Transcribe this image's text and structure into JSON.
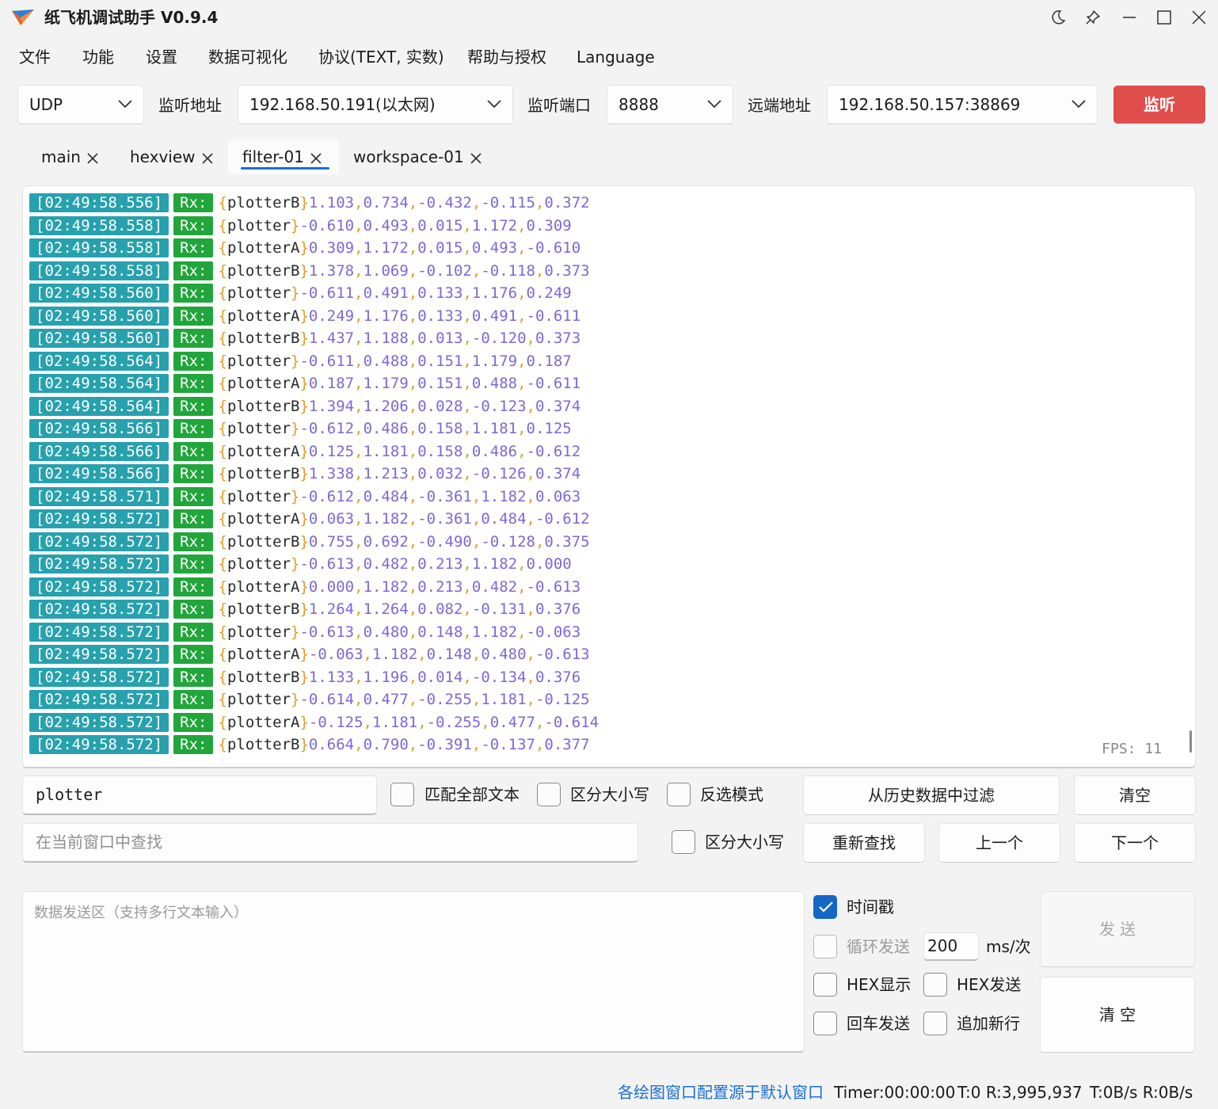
{
  "window": {
    "title": "纸飞机调试助手 V0.9.4"
  },
  "menu": [
    "文件",
    "功能",
    "设置",
    "数据可视化",
    "协议(TEXT, 实数)",
    "帮助与授权",
    "Language"
  ],
  "toolbar": {
    "protocol": "UDP",
    "listen_addr_label": "监听地址",
    "listen_addr": "192.168.50.191(以太网)",
    "listen_port_label": "监听端口",
    "listen_port": "8888",
    "remote_addr_label": "远端地址",
    "remote_addr": "192.168.50.157:38869",
    "listen_button": "监听"
  },
  "tabs": [
    {
      "label": "main",
      "active": false
    },
    {
      "label": "hexview",
      "active": false
    },
    {
      "label": "filter-01",
      "active": true
    },
    {
      "label": "workspace-01",
      "active": false
    }
  ],
  "log": {
    "rx_label": "Rx:",
    "fps": "FPS: 11",
    "rows": [
      {
        "ts": "[02:49:58.556]",
        "name": "plotterB",
        "values": [
          "1.103",
          "0.734",
          "-0.432",
          "-0.115",
          "0.372"
        ]
      },
      {
        "ts": "[02:49:58.558]",
        "name": "plotter",
        "values": [
          "-0.610",
          "0.493",
          "0.015",
          "1.172",
          "0.309"
        ]
      },
      {
        "ts": "[02:49:58.558]",
        "name": "plotterA",
        "values": [
          "0.309",
          "1.172",
          "0.015",
          "0.493",
          "-0.610"
        ]
      },
      {
        "ts": "[02:49:58.558]",
        "name": "plotterB",
        "values": [
          "1.378",
          "1.069",
          "-0.102",
          "-0.118",
          "0.373"
        ]
      },
      {
        "ts": "[02:49:58.560]",
        "name": "plotter",
        "values": [
          "-0.611",
          "0.491",
          "0.133",
          "1.176",
          "0.249"
        ]
      },
      {
        "ts": "[02:49:58.560]",
        "name": "plotterA",
        "values": [
          "0.249",
          "1.176",
          "0.133",
          "0.491",
          "-0.611"
        ]
      },
      {
        "ts": "[02:49:58.560]",
        "name": "plotterB",
        "values": [
          "1.437",
          "1.188",
          "0.013",
          "-0.120",
          "0.373"
        ]
      },
      {
        "ts": "[02:49:58.564]",
        "name": "plotter",
        "values": [
          "-0.611",
          "0.488",
          "0.151",
          "1.179",
          "0.187"
        ]
      },
      {
        "ts": "[02:49:58.564]",
        "name": "plotterA",
        "values": [
          "0.187",
          "1.179",
          "0.151",
          "0.488",
          "-0.611"
        ]
      },
      {
        "ts": "[02:49:58.564]",
        "name": "plotterB",
        "values": [
          "1.394",
          "1.206",
          "0.028",
          "-0.123",
          "0.374"
        ]
      },
      {
        "ts": "[02:49:58.566]",
        "name": "plotter",
        "values": [
          "-0.612",
          "0.486",
          "0.158",
          "1.181",
          "0.125"
        ]
      },
      {
        "ts": "[02:49:58.566]",
        "name": "plotterA",
        "values": [
          "0.125",
          "1.181",
          "0.158",
          "0.486",
          "-0.612"
        ]
      },
      {
        "ts": "[02:49:58.566]",
        "name": "plotterB",
        "values": [
          "1.338",
          "1.213",
          "0.032",
          "-0.126",
          "0.374"
        ]
      },
      {
        "ts": "[02:49:58.571]",
        "name": "plotter",
        "values": [
          "-0.612",
          "0.484",
          "-0.361",
          "1.182",
          "0.063"
        ]
      },
      {
        "ts": "[02:49:58.572]",
        "name": "plotterA",
        "values": [
          "0.063",
          "1.182",
          "-0.361",
          "0.484",
          "-0.612"
        ]
      },
      {
        "ts": "[02:49:58.572]",
        "name": "plotterB",
        "values": [
          "0.755",
          "0.692",
          "-0.490",
          "-0.128",
          "0.375"
        ]
      },
      {
        "ts": "[02:49:58.572]",
        "name": "plotter",
        "values": [
          "-0.613",
          "0.482",
          "0.213",
          "1.182",
          "0.000"
        ]
      },
      {
        "ts": "[02:49:58.572]",
        "name": "plotterA",
        "values": [
          "0.000",
          "1.182",
          "0.213",
          "0.482",
          "-0.613"
        ]
      },
      {
        "ts": "[02:49:58.572]",
        "name": "plotterB",
        "values": [
          "1.264",
          "1.264",
          "0.082",
          "-0.131",
          "0.376"
        ]
      },
      {
        "ts": "[02:49:58.572]",
        "name": "plotter",
        "values": [
          "-0.613",
          "0.480",
          "0.148",
          "1.182",
          "-0.063"
        ]
      },
      {
        "ts": "[02:49:58.572]",
        "name": "plotterA",
        "values": [
          "-0.063",
          "1.182",
          "0.148",
          "0.480",
          "-0.613"
        ]
      },
      {
        "ts": "[02:49:58.572]",
        "name": "plotterB",
        "values": [
          "1.133",
          "1.196",
          "0.014",
          "-0.134",
          "0.376"
        ]
      },
      {
        "ts": "[02:49:58.572]",
        "name": "plotter",
        "values": [
          "-0.614",
          "0.477",
          "-0.255",
          "1.181",
          "-0.125"
        ]
      },
      {
        "ts": "[02:49:58.572]",
        "name": "plotterA",
        "values": [
          "-0.125",
          "1.181",
          "-0.255",
          "0.477",
          "-0.614"
        ]
      },
      {
        "ts": "[02:49:58.572]",
        "name": "plotterB",
        "values": [
          "0.664",
          "0.790",
          "-0.391",
          "-0.137",
          "0.377"
        ]
      }
    ]
  },
  "filter": {
    "value": "plotter",
    "match_all_label": "匹配全部文本",
    "case_label": "区分大小写",
    "invert_label": "反选模式",
    "history_button": "从历史数据中过滤",
    "clear_button": "清空"
  },
  "find": {
    "placeholder": "在当前窗口中查找",
    "case_label": "区分大小写",
    "refind_button": "重新查找",
    "prev_button": "上一个",
    "next_button": "下一个"
  },
  "send": {
    "placeholder": "数据发送区（支持多行文本输入）",
    "timestamp_label": "时间戳",
    "loop_label": "循环发送",
    "interval": "200",
    "interval_unit": "ms/次",
    "hex_display_label": "HEX显示",
    "hex_send_label": "HEX发送",
    "enter_send_label": "回车发送",
    "append_newline_label": "追加新行",
    "send_button": "发 送",
    "clear_button": "清 空"
  },
  "status": {
    "plot_config": "各绘图窗口配置源于默认窗口",
    "timer": "Timer:00:00:00",
    "counts": "T:0 R:3,995,937",
    "rates": "T:0B/s R:0B/s"
  },
  "colors": {
    "accent": "#1567c6",
    "danger": "#e04e4c",
    "timestamp_bg": "#27a1ae",
    "rx_bg": "#20a63a",
    "number": "#7a6ad6",
    "bracket": "#e49b27"
  },
  "icons": [
    "paper-plane-icon",
    "moon-icon",
    "pin-icon",
    "minimize-icon",
    "maximize-icon",
    "close-icon",
    "chevron-down-icon",
    "tab-close-icon",
    "checkmark-icon"
  ]
}
